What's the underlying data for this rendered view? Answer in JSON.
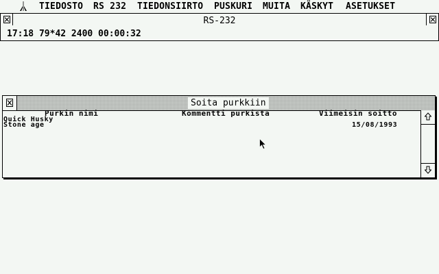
{
  "menubar": {
    "logo_icon": "atari-fuji-icon",
    "items": [
      "TIEDOSTO",
      "RS 232",
      "TIEDONSIIRTO",
      "PUSKURI",
      "MUITA",
      "KÄSKYT",
      "ASETUKSET"
    ]
  },
  "main_window": {
    "title": "RS-232",
    "status": "17:18 79*42 2400 00:00:32"
  },
  "dialog": {
    "title": "Soita purkkiin",
    "columns": [
      "Purkin nimi",
      "Kommentti purkista",
      "Viimeisin soitto"
    ],
    "rows": [
      {
        "name": "Quick Husky",
        "comment": "",
        "last_call": ""
      },
      {
        "name": "Stone age",
        "comment": "",
        "last_call": "15/08/1993"
      }
    ],
    "scroll_up_icon": "arrow-up-icon",
    "scroll_down_icon": "arrow-down-icon"
  },
  "colors": {
    "background": "#f3f7f3",
    "foreground": "#000000"
  }
}
